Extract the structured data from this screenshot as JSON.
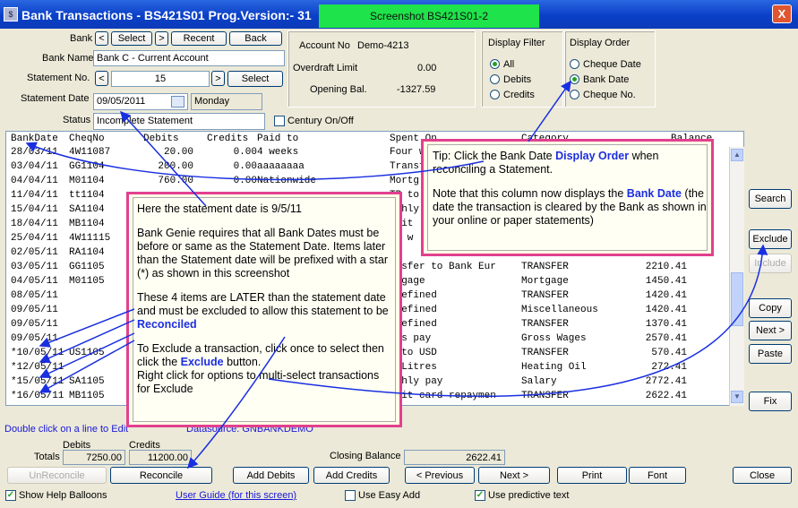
{
  "window": {
    "title": "Bank Transactions  -  BS421S01    Prog.Version:-   31",
    "screenshot_label": "Screenshot BS421S01-2",
    "close": "X"
  },
  "bank": {
    "label": "Bank",
    "prev": "<",
    "select": "Select",
    "next": ">",
    "recent": "Recent",
    "back": "Back"
  },
  "bank_name": {
    "label": "Bank Name",
    "value": "Bank C - Current Account"
  },
  "statement_no": {
    "label": "Statement No.",
    "prev": "<",
    "value": "15",
    "next": ">",
    "select": "Select"
  },
  "statement_date": {
    "label": "Statement Date",
    "value": "09/05/2011",
    "day": "Monday"
  },
  "status": {
    "label": "Status",
    "value": "Incomplete Statement"
  },
  "century": {
    "label": "Century On/Off"
  },
  "account": {
    "account_no_label": "Account No",
    "account_no": "Demo-4213",
    "overdraft_label": "Overdraft Limit",
    "overdraft": "0.00",
    "opening_label": "Opening Bal.",
    "opening": "-1327.59"
  },
  "display_filter": {
    "title": "Display Filter",
    "options": [
      "All",
      "Debits",
      "Credits"
    ],
    "selected": "All"
  },
  "display_order": {
    "title": "Display Order",
    "options": [
      "Cheque Date",
      "Bank Date",
      "Cheque No."
    ],
    "selected": "Bank Date"
  },
  "grid": {
    "headers": [
      "BankDate",
      "CheqNo",
      "Debits",
      "Credits",
      "Paid to",
      "Spent On",
      "Category",
      "Balance"
    ],
    "rows": [
      {
        "date": "28/03/11",
        "cheq": "4W11087",
        "debits": "20.00",
        "credits": "0.00",
        "paid": "4 weeks",
        "spent": "Four w",
        "cat": "",
        "bal": "41"
      },
      {
        "date": "03/04/11",
        "cheq": "GG1104",
        "debits": "200.00",
        "credits": "0.00",
        "paid": "aaaaaaaa",
        "spent": "Transf",
        "cat": "",
        "bal": "41"
      },
      {
        "date": "04/04/11",
        "cheq": "M01104",
        "debits": "760.00",
        "credits": "0.00",
        "paid": "Nationwide",
        "spent": "Mortg",
        "cat": "",
        "bal": "41"
      },
      {
        "date": "11/04/11",
        "cheq": "tt1104",
        "debits": "",
        "credits": "",
        "paid": "",
        "spent": "TP to",
        "cat": "",
        "bal": "41"
      },
      {
        "date": "15/04/11",
        "cheq": "SA1104",
        "debits": "",
        "credits": "",
        "paid": "",
        "spent": "nthly",
        "cat": "",
        "bal": "41"
      },
      {
        "date": "18/04/11",
        "cheq": "MB1104",
        "debits": "",
        "credits": "",
        "paid": "",
        "spent": "edit",
        "cat": "",
        "bal": "41"
      },
      {
        "date": "25/04/11",
        "cheq": "4W11115",
        "debits": "",
        "credits": "",
        "paid": "",
        "spent": "ur w",
        "cat": "",
        "bal": "41"
      },
      {
        "date": "02/05/11",
        "cheq": "RA1104",
        "debits": "",
        "credits": "",
        "paid": "",
        "spent": "ss",
        "cat": "",
        "bal": "41"
      },
      {
        "date": "03/05/11",
        "cheq": "GG1105",
        "debits": "",
        "credits": "",
        "paid": "",
        "spent": "ansfer to Bank Eur",
        "cat": "TRANSFER",
        "bal": "2210.41"
      },
      {
        "date": "04/05/11",
        "cheq": "M01105",
        "debits": "",
        "credits": "",
        "paid": "",
        "spent": "rtgage",
        "cat": "Mortgage",
        "bal": "1450.41"
      },
      {
        "date": "08/05/11",
        "cheq": "",
        "debits": "",
        "credits": "",
        "paid": "",
        "spent": "-defined",
        "cat": "TRANSFER",
        "bal": "1420.41"
      },
      {
        "date": "09/05/11",
        "cheq": "",
        "debits": "",
        "credits": "",
        "paid": "",
        "spent": "-defined",
        "cat": "Miscellaneous",
        "bal": "1420.41"
      },
      {
        "date": "09/05/11",
        "cheq": "",
        "debits": "",
        "credits": "",
        "paid": "",
        "spent": "-defined",
        "cat": "TRANSFER",
        "bal": "1370.41"
      },
      {
        "date": "09/05/11",
        "cheq": "",
        "debits": "",
        "credits": "",
        "paid": "",
        "spent": "oss pay",
        "cat": "Gross Wages",
        "bal": "2570.41"
      },
      {
        "date": "*10/05/11",
        "cheq": "US1105",
        "debits": "",
        "credits": "",
        "paid": "",
        "spent": "P to USD",
        "cat": "TRANSFER",
        "bal": "570.41"
      },
      {
        "date": "*12/05/11",
        "cheq": "",
        "debits": "",
        "credits": "",
        "paid": "",
        "spent": "0 Litres",
        "cat": "Heating Oil",
        "bal": "272.41"
      },
      {
        "date": "*15/05/11",
        "cheq": "SA1105",
        "debits": "",
        "credits": "",
        "paid": "",
        "spent": "nthly pay",
        "cat": "Salary",
        "bal": "2772.41"
      },
      {
        "date": "*16/05/11",
        "cheq": "MB1105",
        "debits": "",
        "credits": "",
        "paid": "",
        "spent": "edit card repaymen",
        "cat": "TRANSFER",
        "bal": "2622.41"
      }
    ]
  },
  "side_buttons": {
    "search": "Search",
    "exclude": "Exclude",
    "include": "Include",
    "copy": "Copy",
    "next": "Next >",
    "paste": "Paste",
    "fix": "Fix"
  },
  "footer": {
    "double_click_note": "Double click on a line to Edit",
    "datasource_note": "Datasource: GNBANKDEMO",
    "totals_label": "Totals",
    "debits_label": "Debits",
    "debits": "7250.00",
    "credits_label": "Credits",
    "credits": "11200.00",
    "closing_label": "Closing Balance",
    "closing": "2622.41",
    "unreconcile": "UnReconcile",
    "reconcile": "Reconcile",
    "add_debits": "Add Debits",
    "add_credits": "Add Credits",
    "previous": "< Previous",
    "next": "Next >",
    "print": "Print",
    "font": "Font",
    "close": "Close",
    "show_help": "Show Help Balloons",
    "user_guide": "User Guide (for this screen)",
    "easy_add": "Use Easy Add",
    "predictive": "Use predictive text"
  },
  "tip1": {
    "p1": "Tip: Click the Bank Date",
    "p1_hl": "Display Order",
    "p1_end": "when reconciling a Statement.",
    "p2": "Note that this column now displays the",
    "p2_hl": "Bank Date",
    "p2_end": "(the date the transaction is cleared by the Bank as shown in your online or paper statements)"
  },
  "tip2": {
    "p1": "Here the statement date is 9/5/11",
    "p2": "Bank Genie requires that all Bank Dates must be before or same as the Statement Date. Items later than the Statement date will be prefixed with a star (*) as shown in this screenshot",
    "p3": "These 4 items are LATER than the statement date and must be excluded to allow this statement to be",
    "p3_hl": "Reconciled",
    "p4a": "To Exclude a transaction, click once to select then click the",
    "p4_hl": "Exclude",
    "p4b": "button.",
    "p5": "Right click for options to multi-select transactions for Exclude"
  }
}
